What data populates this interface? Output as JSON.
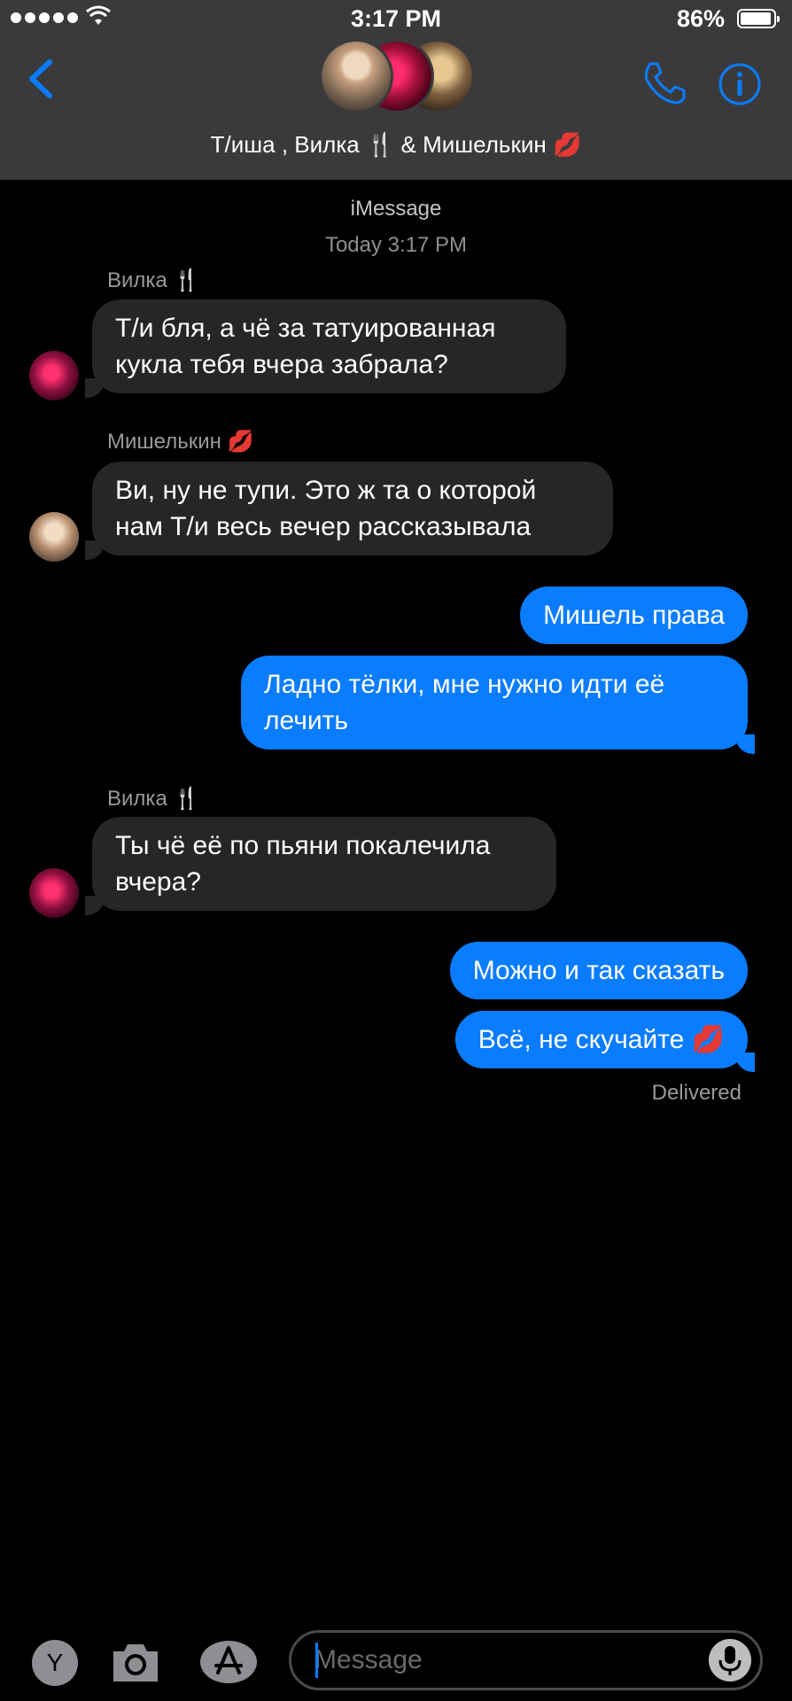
{
  "status_bar": {
    "time": "3:17 PM",
    "battery": "86%"
  },
  "header": {
    "title": "Т/иша , Вилка 🍴 & Мишелькин 💋"
  },
  "conversation": {
    "service": "iMessage",
    "timestamp": "Today 3:17 PM",
    "delivered": "Delivered",
    "messages": [
      {
        "sender": "Вилка 🍴",
        "text": "Т/и бля, а чё за татуированная кукла тебя вчера забрала?"
      },
      {
        "sender": "Мишелькин 💋",
        "text": "Ви, ну не тупи. Это ж та о которой нам Т/и весь вечер рассказывала"
      },
      {
        "text": "Мишель права"
      },
      {
        "text": "Ладно тёлки, мне нужно идти её лечить"
      },
      {
        "sender": "Вилка 🍴",
        "text": "Ты чё её по пьяни покалечила вчера?"
      },
      {
        "text": "Можно и так сказать"
      },
      {
        "text": "Всё, не скучайте 💋"
      }
    ]
  },
  "input": {
    "placeholder": "Message",
    "y_label": "Y"
  },
  "colors": {
    "accent": "#0a7cff",
    "header_bg": "#3a3a3c",
    "incoming_bubble": "#262629",
    "background": "#000000"
  }
}
